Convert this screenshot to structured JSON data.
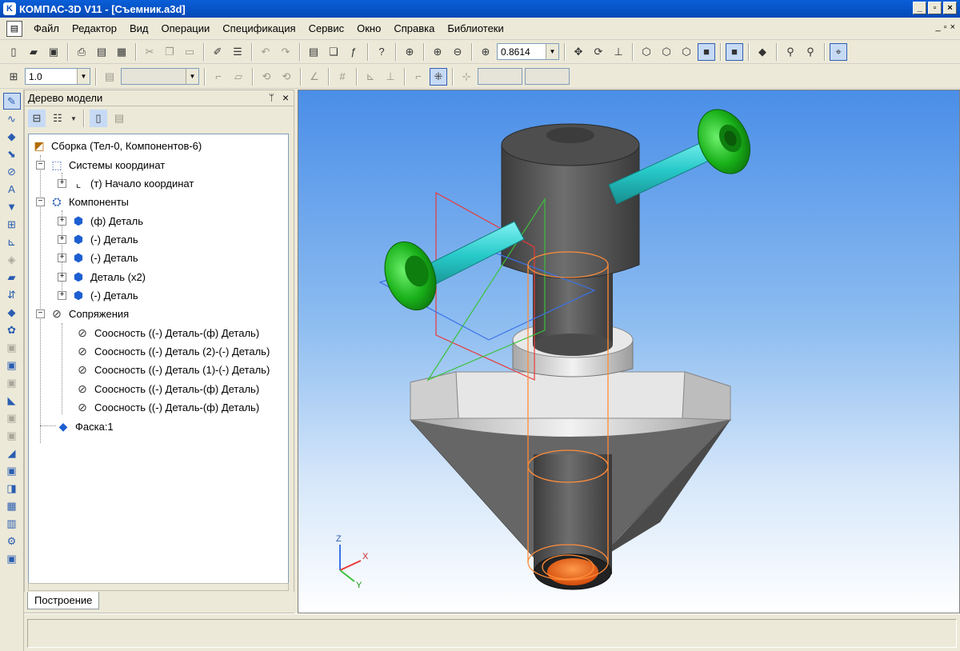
{
  "window": {
    "title": "КОМПАС-3D V11 - [Съемник.a3d]",
    "logo": "K",
    "minimize_icon": "_",
    "restore_icon": "▫",
    "close_icon": "×"
  },
  "menu": {
    "items": [
      "Файл",
      "Редактор",
      "Вид",
      "Операции",
      "Спецификация",
      "Сервис",
      "Окно",
      "Справка",
      "Библиотеки"
    ],
    "mdi_icons": [
      "_",
      "▫",
      "×"
    ]
  },
  "toolbar": {
    "zoom_value": "0.8614",
    "line_width": "1.0"
  },
  "tree_panel": {
    "title": "Дерево модели",
    "pin_icon": "pin-icon",
    "close_icon": "close-icon",
    "root": "Сборка (Тел-0, Компонентов-6)",
    "coordinate_systems": "Системы координат",
    "origin": "(т) Начало координат",
    "components_label": "Компоненты",
    "components": [
      "(ф) Деталь",
      "(-) Деталь",
      "(-) Деталь",
      "Деталь (x2)",
      "(-) Деталь"
    ],
    "mates_label": "Сопряжения",
    "mates": [
      "Соосность ((-) Деталь-(ф) Деталь)",
      "Соосность ((-) Деталь (2)-(-) Деталь)",
      "Соосность ((-) Деталь (1)-(-) Деталь)",
      "Соосность ((-) Деталь-(ф) Деталь)",
      "Соосность ((-) Деталь-(ф) Деталь)"
    ],
    "chamfer": "Фаска:1",
    "tab_label": "Построение"
  },
  "viewport": {
    "axis_x": "X",
    "axis_y": "Y",
    "axis_z": "Z",
    "colors": {
      "body_gray": "#5f5f5f",
      "light_gray": "#dcdcdc",
      "handle_cyan": "#2fd6d6",
      "knob_green": "#1fb81f",
      "edge_orange": "#ff8c3a",
      "plane_red": "#e83a3a",
      "plane_green": "#3ac23a",
      "plane_blue": "#3a72e8"
    }
  }
}
